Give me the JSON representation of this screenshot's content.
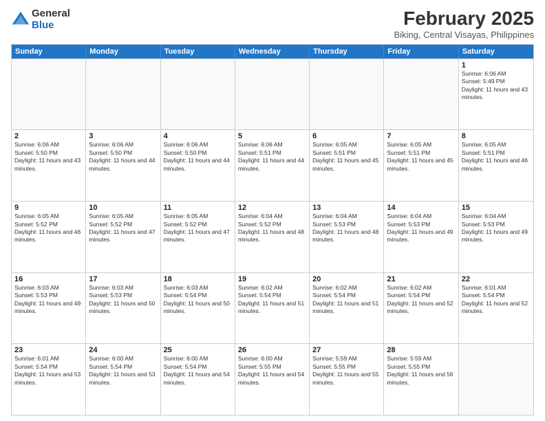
{
  "logo": {
    "general": "General",
    "blue": "Blue"
  },
  "header": {
    "month": "February 2025",
    "location": "Biking, Central Visayas, Philippines"
  },
  "weekdays": [
    "Sunday",
    "Monday",
    "Tuesday",
    "Wednesday",
    "Thursday",
    "Friday",
    "Saturday"
  ],
  "rows": [
    [
      {
        "day": "",
        "info": ""
      },
      {
        "day": "",
        "info": ""
      },
      {
        "day": "",
        "info": ""
      },
      {
        "day": "",
        "info": ""
      },
      {
        "day": "",
        "info": ""
      },
      {
        "day": "",
        "info": ""
      },
      {
        "day": "1",
        "info": "Sunrise: 6:06 AM\nSunset: 5:49 PM\nDaylight: 11 hours and 43 minutes."
      }
    ],
    [
      {
        "day": "2",
        "info": "Sunrise: 6:06 AM\nSunset: 5:50 PM\nDaylight: 11 hours and 43 minutes."
      },
      {
        "day": "3",
        "info": "Sunrise: 6:06 AM\nSunset: 5:50 PM\nDaylight: 11 hours and 44 minutes."
      },
      {
        "day": "4",
        "info": "Sunrise: 6:06 AM\nSunset: 5:50 PM\nDaylight: 11 hours and 44 minutes."
      },
      {
        "day": "5",
        "info": "Sunrise: 6:06 AM\nSunset: 5:51 PM\nDaylight: 11 hours and 44 minutes."
      },
      {
        "day": "6",
        "info": "Sunrise: 6:05 AM\nSunset: 5:51 PM\nDaylight: 11 hours and 45 minutes."
      },
      {
        "day": "7",
        "info": "Sunrise: 6:05 AM\nSunset: 5:51 PM\nDaylight: 11 hours and 45 minutes."
      },
      {
        "day": "8",
        "info": "Sunrise: 6:05 AM\nSunset: 5:51 PM\nDaylight: 11 hours and 46 minutes."
      }
    ],
    [
      {
        "day": "9",
        "info": "Sunrise: 6:05 AM\nSunset: 5:52 PM\nDaylight: 11 hours and 46 minutes."
      },
      {
        "day": "10",
        "info": "Sunrise: 6:05 AM\nSunset: 5:52 PM\nDaylight: 11 hours and 47 minutes."
      },
      {
        "day": "11",
        "info": "Sunrise: 6:05 AM\nSunset: 5:52 PM\nDaylight: 11 hours and 47 minutes."
      },
      {
        "day": "12",
        "info": "Sunrise: 6:04 AM\nSunset: 5:52 PM\nDaylight: 11 hours and 48 minutes."
      },
      {
        "day": "13",
        "info": "Sunrise: 6:04 AM\nSunset: 5:53 PM\nDaylight: 11 hours and 48 minutes."
      },
      {
        "day": "14",
        "info": "Sunrise: 6:04 AM\nSunset: 5:53 PM\nDaylight: 11 hours and 49 minutes."
      },
      {
        "day": "15",
        "info": "Sunrise: 6:04 AM\nSunset: 5:53 PM\nDaylight: 11 hours and 49 minutes."
      }
    ],
    [
      {
        "day": "16",
        "info": "Sunrise: 6:03 AM\nSunset: 5:53 PM\nDaylight: 11 hours and 49 minutes."
      },
      {
        "day": "17",
        "info": "Sunrise: 6:03 AM\nSunset: 5:53 PM\nDaylight: 11 hours and 50 minutes."
      },
      {
        "day": "18",
        "info": "Sunrise: 6:03 AM\nSunset: 5:54 PM\nDaylight: 11 hours and 50 minutes."
      },
      {
        "day": "19",
        "info": "Sunrise: 6:02 AM\nSunset: 5:54 PM\nDaylight: 11 hours and 51 minutes."
      },
      {
        "day": "20",
        "info": "Sunrise: 6:02 AM\nSunset: 5:54 PM\nDaylight: 11 hours and 51 minutes."
      },
      {
        "day": "21",
        "info": "Sunrise: 6:02 AM\nSunset: 5:54 PM\nDaylight: 11 hours and 52 minutes."
      },
      {
        "day": "22",
        "info": "Sunrise: 6:01 AM\nSunset: 5:54 PM\nDaylight: 11 hours and 52 minutes."
      }
    ],
    [
      {
        "day": "23",
        "info": "Sunrise: 6:01 AM\nSunset: 5:54 PM\nDaylight: 11 hours and 53 minutes."
      },
      {
        "day": "24",
        "info": "Sunrise: 6:00 AM\nSunset: 5:54 PM\nDaylight: 11 hours and 53 minutes."
      },
      {
        "day": "25",
        "info": "Sunrise: 6:00 AM\nSunset: 5:54 PM\nDaylight: 11 hours and 54 minutes."
      },
      {
        "day": "26",
        "info": "Sunrise: 6:00 AM\nSunset: 5:55 PM\nDaylight: 11 hours and 54 minutes."
      },
      {
        "day": "27",
        "info": "Sunrise: 5:59 AM\nSunset: 5:55 PM\nDaylight: 11 hours and 55 minutes."
      },
      {
        "day": "28",
        "info": "Sunrise: 5:59 AM\nSunset: 5:55 PM\nDaylight: 11 hours and 56 minutes."
      },
      {
        "day": "",
        "info": ""
      }
    ]
  ]
}
